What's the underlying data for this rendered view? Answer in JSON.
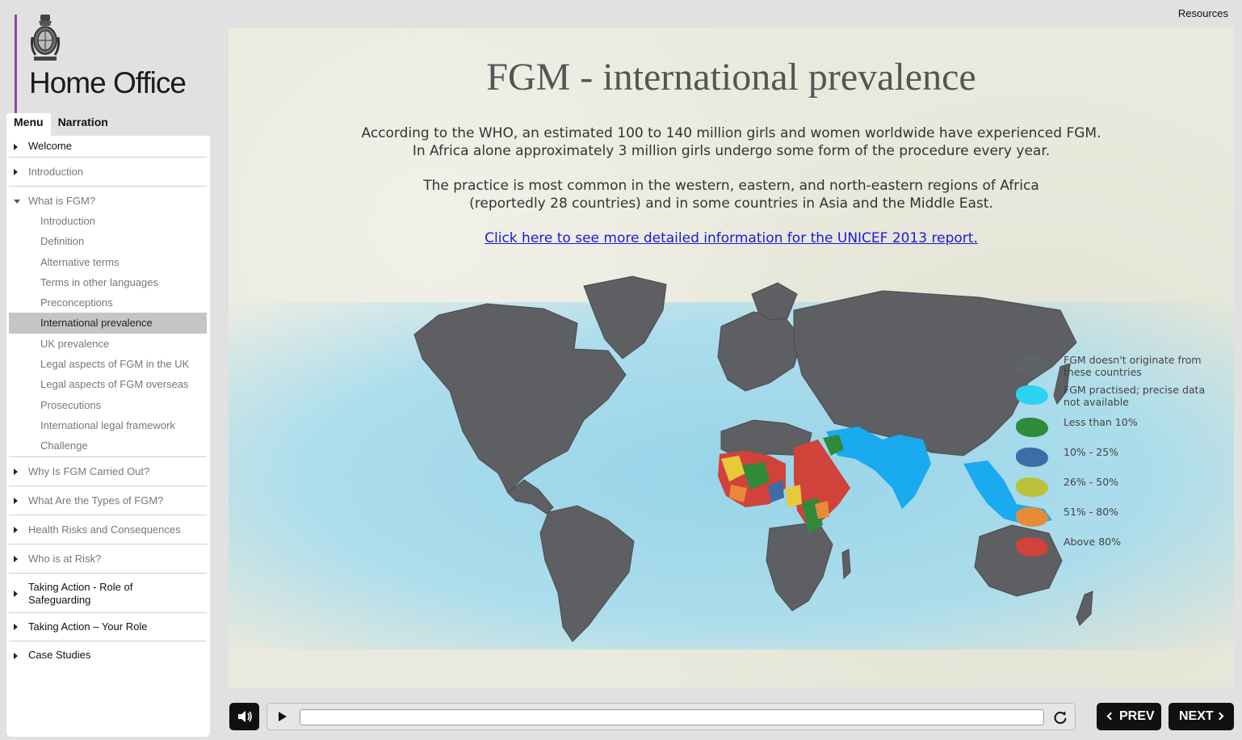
{
  "header": {
    "logo_text": "Home Office",
    "resources_label": "Resources"
  },
  "tabs": {
    "menu": "Menu",
    "narration": "Narration"
  },
  "sidebar": {
    "sections": [
      {
        "label": "Welcome"
      },
      {
        "label": "Introduction"
      },
      {
        "label": "What is FGM?",
        "children": [
          "Introduction",
          "Definition",
          "Alternative terms",
          "Terms in other languages",
          "Preconceptions",
          "International prevalence",
          "UK prevalence",
          "Legal aspects of FGM in the UK",
          "Legal aspects of FGM overseas",
          "Prosecutions",
          "International legal framework",
          "Challenge"
        ]
      },
      {
        "label": "Why Is FGM Carried Out?"
      },
      {
        "label": "What Are the Types of FGM?"
      },
      {
        "label": "Health Risks and Consequences"
      },
      {
        "label": "Who is at Risk?"
      },
      {
        "label": "Taking Action - Role of Safeguarding"
      },
      {
        "label": "Taking Action – Your Role"
      },
      {
        "label": "Case Studies"
      }
    ],
    "selected": "International prevalence"
  },
  "slide": {
    "title": "FGM - international prevalence",
    "para1_line1": "According to the WHO, an estimated 100 to 140 million girls and women worldwide have experienced FGM.",
    "para1_line2": "In Africa alone approximately 3 million girls undergo some form of the procedure every year.",
    "para2_line1": "The practice is most common in the western, eastern, and north-eastern regions of Africa",
    "para2_line2": "(reportedly 28 countries) and in some countries in Asia and the Middle East.",
    "link_text": "Click here to see more detailed information for the UNICEF 2013 report.",
    "legend": [
      {
        "label": "FGM doesn't originate from these countries",
        "color": "#5f6266"
      },
      {
        "label": "FGM practised; precise data not available",
        "color": "#2ad3f0"
      },
      {
        "label": "Less than 10%",
        "color": "#2f8a3a"
      },
      {
        "label": "10% - 25%",
        "color": "#3c6da6"
      },
      {
        "label": "26% - 50%",
        "color": "#b9c23a"
      },
      {
        "label": "51% - 80%",
        "color": "#e88a3a"
      },
      {
        "label": "Above 80%",
        "color": "#d0433a"
      }
    ]
  },
  "player": {
    "progress": 0.0
  },
  "nav": {
    "prev": "PREV",
    "next": "NEXT"
  }
}
